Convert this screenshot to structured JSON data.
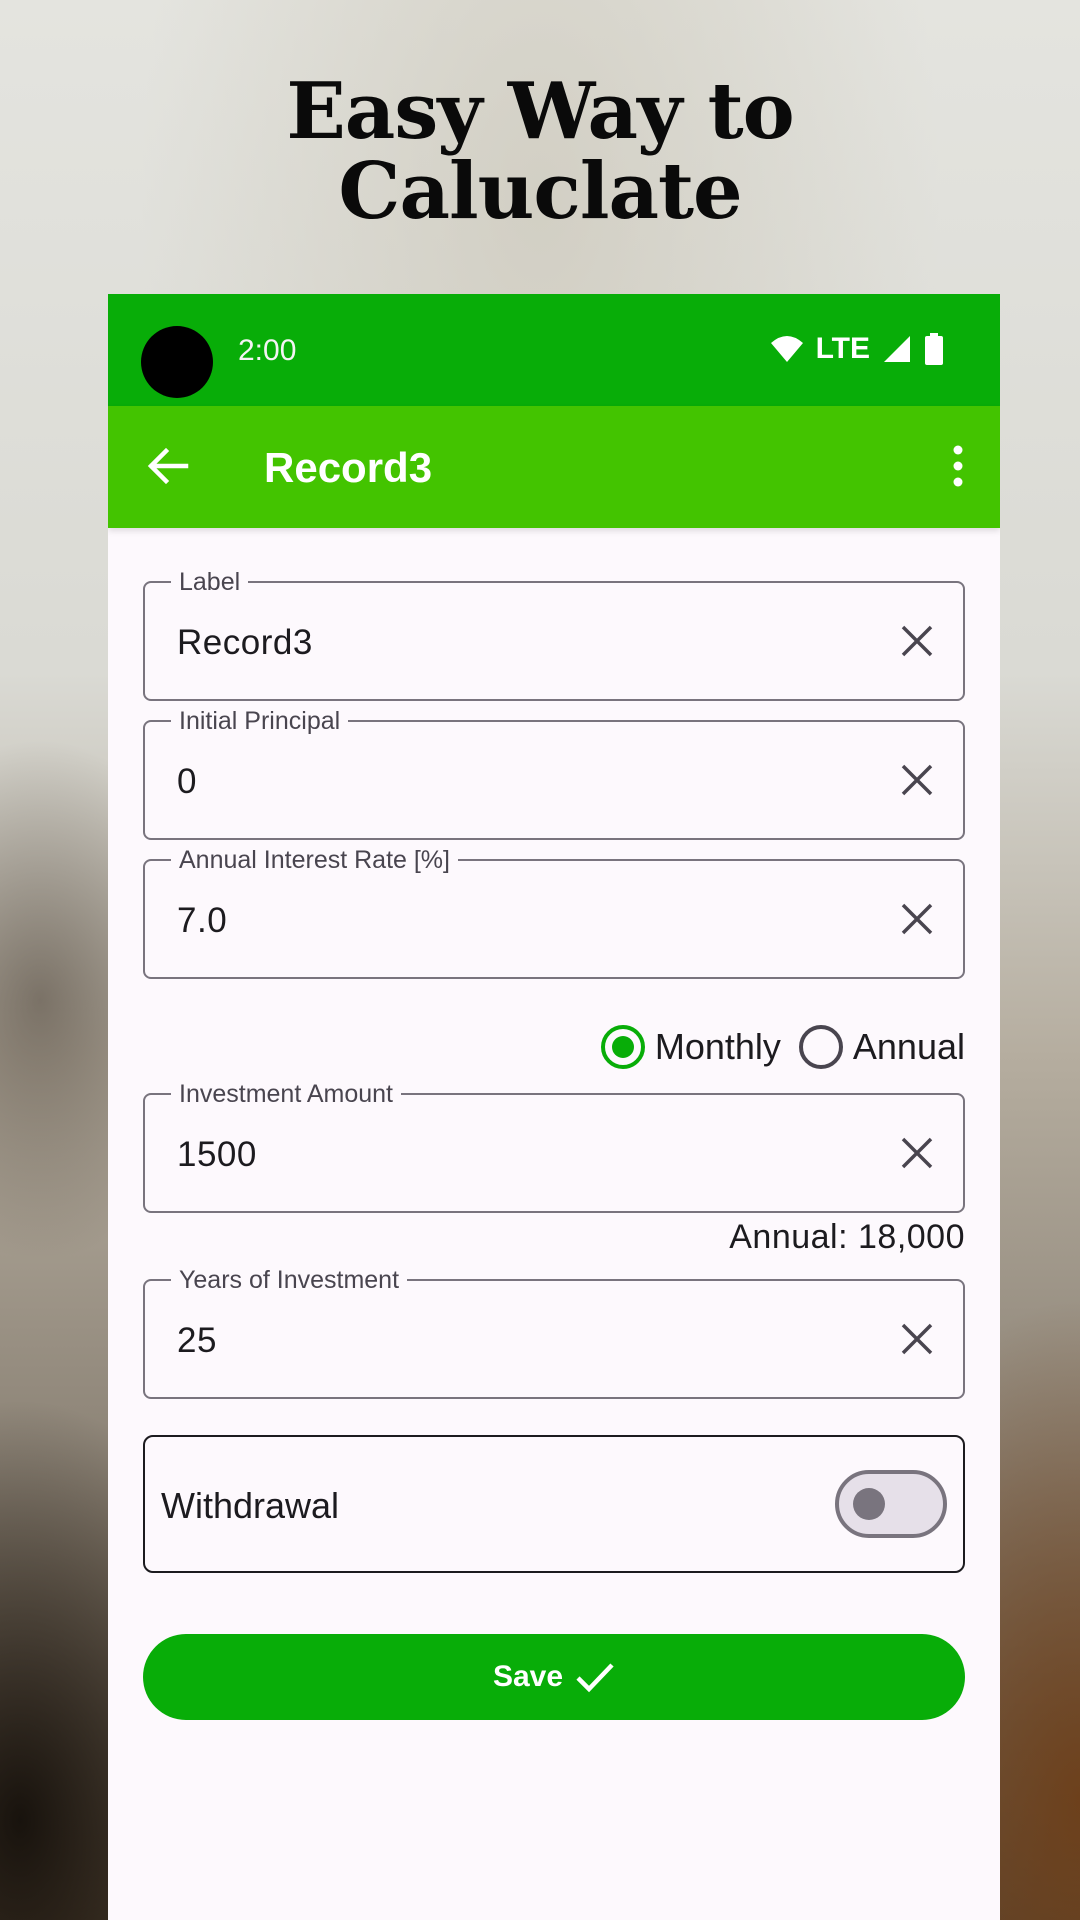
{
  "promo": {
    "headline_line1": "Easy Way to",
    "headline_line2": "Caluclate"
  },
  "status_bar": {
    "time": "2:00",
    "network": "LTE",
    "icons": [
      "wifi-icon",
      "cell-signal-icon",
      "battery-icon"
    ]
  },
  "app_bar": {
    "title": "Record3",
    "back_icon": "arrow-left-icon",
    "menu_icon": "more-vert-icon"
  },
  "form": {
    "label_field": {
      "label": "Label",
      "value": "Record3"
    },
    "principal_field": {
      "label": "Initial Principal",
      "value": "0"
    },
    "rate_field": {
      "label": "Annual Interest Rate [%]",
      "value": "7.0"
    },
    "frequency": {
      "options": [
        "Monthly",
        "Annual"
      ],
      "selected": "Monthly"
    },
    "investment_field": {
      "label": "Investment Amount",
      "value": "1500"
    },
    "annual_note": "Annual: 18,000",
    "years_field": {
      "label": "Years of Investment",
      "value": "25"
    },
    "withdrawal": {
      "label": "Withdrawal",
      "enabled": false
    },
    "save_label": "Save"
  },
  "colors": {
    "status_bar": "#08ad08",
    "app_bar": "#43c400",
    "accent": "#08ad08"
  }
}
